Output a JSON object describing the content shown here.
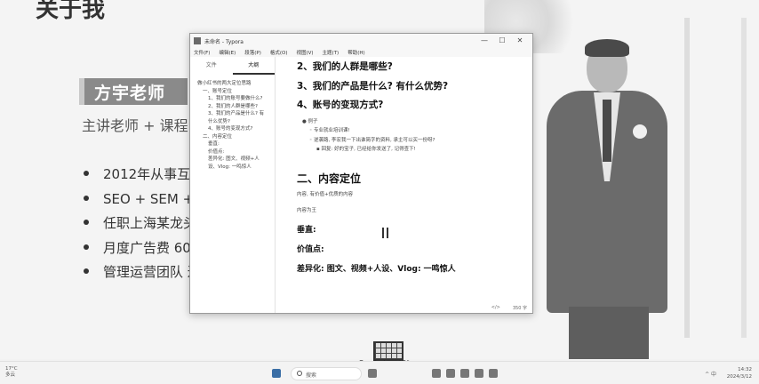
{
  "slide": {
    "title": "关于我",
    "name": "方宇老师",
    "subtitle": "主讲老师 + 课程",
    "bullets": [
      "2012年从事互联",
      "SEO + SEM + 才",
      "任职上海某龙头",
      "月度广告费 600",
      "管理运营团队 近"
    ]
  },
  "window": {
    "title": "未命名 - Typora",
    "menu": [
      "文件(F)",
      "编辑(E)",
      "段落(P)",
      "格式(O)",
      "视图(V)",
      "主题(T)",
      "帮助(H)"
    ],
    "controls": [
      "—",
      "☐",
      "✕"
    ],
    "sidebar": {
      "tabs": [
        "文件",
        "大纲"
      ],
      "active_tab": "大纲",
      "toc": [
        {
          "text": "做小红书的两大定位思路",
          "level": 1
        },
        {
          "text": "一、账号定位",
          "level": 2
        },
        {
          "text": "1、我们的账号要做什么?",
          "level": 3
        },
        {
          "text": "2、我们的人群是哪些?",
          "level": 3
        },
        {
          "text": "3、我们的产品是什么? 有",
          "level": 3
        },
        {
          "text": "什么优势?",
          "level": 3
        },
        {
          "text": "4、账号的变现方式?",
          "level": 3
        },
        {
          "text": "二、内容定位",
          "level": 2
        },
        {
          "text": "垂直:",
          "level": 3
        },
        {
          "text": "价值点:",
          "level": 3
        },
        {
          "text": "差异化: 图文、视频+人",
          "level": 3
        },
        {
          "text": "设、Vlog: 一鸣惊人",
          "level": 3
        }
      ]
    },
    "content": {
      "h2_1": "2、我们的人群是哪些?",
      "h2_2": "3、我们的产品是什么? 有什么优势?",
      "h2_3": "4、账号的变现方式?",
      "notes": [
        "● 例子",
        "◦ 专业就业培训课!",
        "◦ 逆袭路, 李宏我一下出谁简字的资料, 承主可以买一份呀?",
        "▪ 回复: 好的宝子, 已经给你发送了, 记得查下!"
      ],
      "h1": "二、内容定位",
      "line1": "内容, 有价值+优质的内容",
      "line2": "内容为王",
      "label_vertical": "垂直:",
      "label_value": "价值点:",
      "label_diff": "差异化: 图文、视频+人设、Vlog: 一鸣惊人"
    },
    "status": [
      "</>",
      "350 字"
    ]
  },
  "logo": {
    "text": "大咖课堂"
  },
  "taskbar": {
    "weather": [
      "17°C",
      "多云"
    ],
    "search": "搜索",
    "tray": "^ 中",
    "time": "14:32",
    "date": "2024/3/12"
  }
}
